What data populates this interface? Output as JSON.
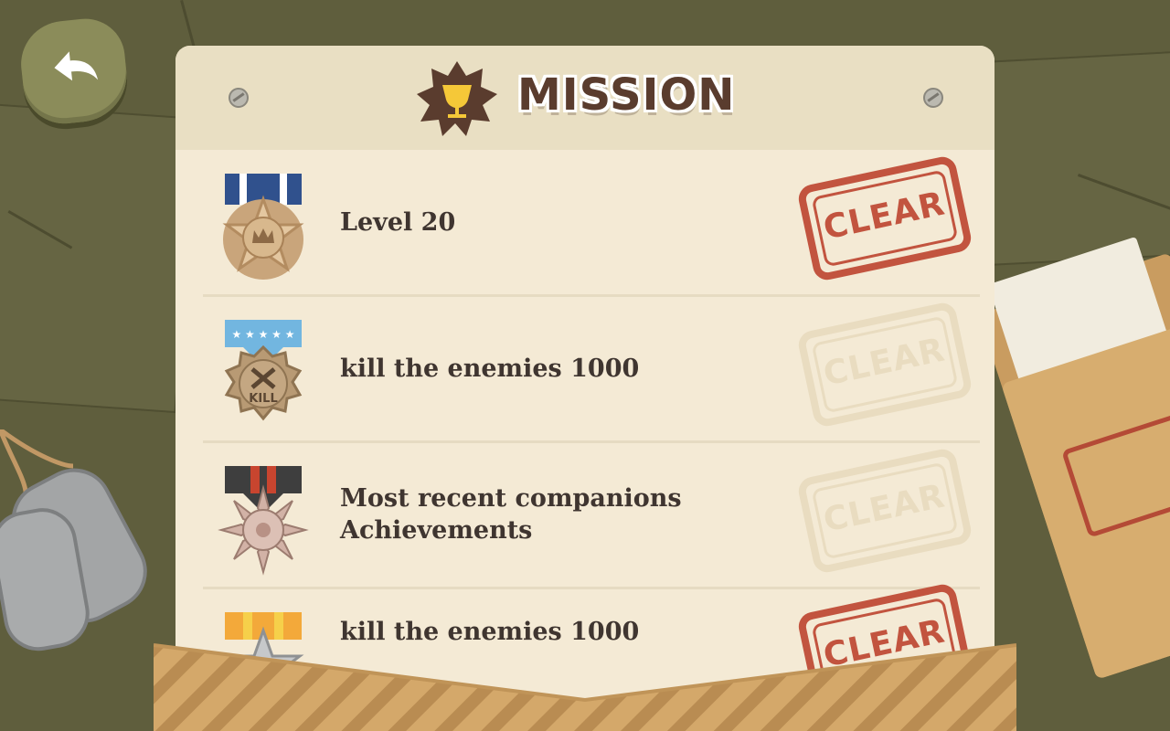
{
  "screen": {
    "title": "MISSION"
  },
  "colors": {
    "accent": "#c2543f",
    "panel": "#f4ead5",
    "title_text": "#5a3c2e"
  },
  "icons": {
    "back": "back-arrow-icon",
    "title": "trophy-icon"
  },
  "missions": [
    {
      "label": "Level 20",
      "medal": "star-medal",
      "stamp": "CLEAR",
      "cleared": true
    },
    {
      "label": "kill the enemies 1000",
      "medal": "kill-medal",
      "medal_text": "KILL",
      "stamp": "CLEAR",
      "cleared": false
    },
    {
      "label": "Most recent companions\nAchievements",
      "medal": "gear-medal",
      "stamp": "CLEAR",
      "cleared": false
    },
    {
      "label": "kill the enemies 1000",
      "medal": "gold-star-medal",
      "stamp": "CLEAR",
      "cleared": true
    }
  ]
}
